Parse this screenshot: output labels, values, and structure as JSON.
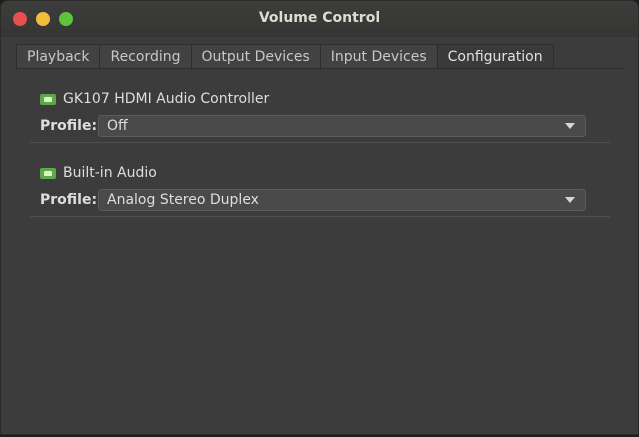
{
  "window": {
    "title": "Volume Control"
  },
  "tabs": [
    {
      "label": "Playback"
    },
    {
      "label": "Recording"
    },
    {
      "label": "Output Devices"
    },
    {
      "label": "Input Devices"
    },
    {
      "label": "Configuration",
      "active": true
    }
  ],
  "cards": [
    {
      "name": "GK107 HDMI Audio Controller",
      "profile_label": "Profile:",
      "profile": "Off",
      "icon": "sound-card-icon"
    },
    {
      "name": "Built-in Audio",
      "profile_label": "Profile:",
      "profile": "Analog Stereo Duplex",
      "icon": "sound-card-icon"
    }
  ],
  "colors": {
    "close": "#e94f4f",
    "minimize": "#f0be3c",
    "maximize": "#5fc33d",
    "icon": "#5fa84a"
  }
}
